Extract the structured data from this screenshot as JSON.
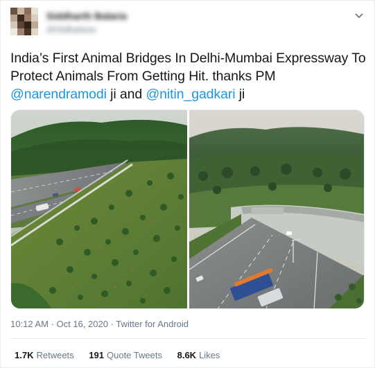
{
  "tweet": {
    "author_name": "Siddharth Balaria",
    "author_handle": "@Sidbalaria",
    "text_part1": "India’s First Animal Bridges In Delhi-Mumbai Expressway To Protect Animals From Getting Hit. thanks PM ",
    "mention1": "@narendramodi",
    "text_part2": " ji and ",
    "mention2": "@nitin_gadkari",
    "text_part3": " ji",
    "timestamp": "10:12 AM · Oct 16, 2020 · Twitter for Android",
    "colors": {
      "mention": "#1b95e0",
      "secondary": "#657786",
      "border": "#e6ecf0"
    },
    "icons": {
      "menu": "chevron-down-icon"
    },
    "media": [
      {
        "alt": "Forested animal overpass crossing a multi-lane highway"
      },
      {
        "alt": "Green animal bridge over a highway with a bus and truck"
      }
    ]
  },
  "stats": {
    "retweets_count": "1.7K",
    "retweets_label": "Retweets",
    "quotes_count": "191",
    "quotes_label": "Quote Tweets",
    "likes_count": "8.6K",
    "likes_label": "Likes"
  }
}
